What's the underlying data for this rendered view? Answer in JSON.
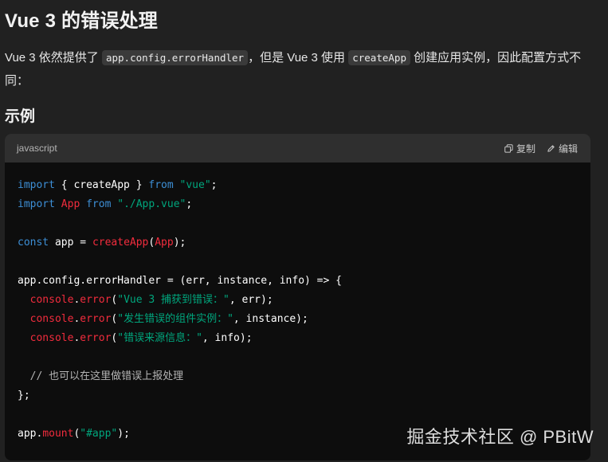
{
  "heading": "Vue 3 的错误处理",
  "paragraph": {
    "part1": "Vue 3 依然提供了 ",
    "code1": "app.config.errorHandler",
    "part2": "，但是 Vue 3 使用 ",
    "code2": "createApp",
    "part3": " 创建应用实例，因此配置方式不同："
  },
  "section_title": "示例",
  "code_block": {
    "language": "javascript",
    "copy_label": "复制",
    "edit_label": "编辑",
    "lines": [
      [
        {
          "t": "import",
          "c": "kw"
        },
        {
          "t": " { createApp } ",
          "c": "plain"
        },
        {
          "t": "from",
          "c": "kw"
        },
        {
          "t": " ",
          "c": "plain"
        },
        {
          "t": "\"vue\"",
          "c": "str"
        },
        {
          "t": ";",
          "c": "plain"
        }
      ],
      [
        {
          "t": "import",
          "c": "kw"
        },
        {
          "t": " ",
          "c": "plain"
        },
        {
          "t": "App",
          "c": "fn"
        },
        {
          "t": " ",
          "c": "plain"
        },
        {
          "t": "from",
          "c": "kw"
        },
        {
          "t": " ",
          "c": "plain"
        },
        {
          "t": "\"./App.vue\"",
          "c": "str"
        },
        {
          "t": ";",
          "c": "plain"
        }
      ],
      [],
      [
        {
          "t": "const",
          "c": "kw"
        },
        {
          "t": " app = ",
          "c": "plain"
        },
        {
          "t": "createApp",
          "c": "fn"
        },
        {
          "t": "(",
          "c": "plain"
        },
        {
          "t": "App",
          "c": "fn"
        },
        {
          "t": ");",
          "c": "plain"
        }
      ],
      [],
      [
        {
          "t": "app.config.errorHandler = (err, instance, info) => {",
          "c": "plain"
        }
      ],
      [
        {
          "t": "  ",
          "c": "plain"
        },
        {
          "t": "console",
          "c": "fn"
        },
        {
          "t": ".",
          "c": "plain"
        },
        {
          "t": "error",
          "c": "fn"
        },
        {
          "t": "(",
          "c": "plain"
        },
        {
          "t": "\"Vue 3 捕获到错误：\"",
          "c": "str"
        },
        {
          "t": ", err);",
          "c": "plain"
        }
      ],
      [
        {
          "t": "  ",
          "c": "plain"
        },
        {
          "t": "console",
          "c": "fn"
        },
        {
          "t": ".",
          "c": "plain"
        },
        {
          "t": "error",
          "c": "fn"
        },
        {
          "t": "(",
          "c": "plain"
        },
        {
          "t": "\"发生错误的组件实例：\"",
          "c": "str"
        },
        {
          "t": ", instance);",
          "c": "plain"
        }
      ],
      [
        {
          "t": "  ",
          "c": "plain"
        },
        {
          "t": "console",
          "c": "fn"
        },
        {
          "t": ".",
          "c": "plain"
        },
        {
          "t": "error",
          "c": "fn"
        },
        {
          "t": "(",
          "c": "plain"
        },
        {
          "t": "\"错误来源信息：\"",
          "c": "str"
        },
        {
          "t": ", info);",
          "c": "plain"
        }
      ],
      [],
      [
        {
          "t": "  // 也可以在这里做错误上报处理",
          "c": "cm"
        }
      ],
      [
        {
          "t": "};",
          "c": "plain"
        }
      ],
      [],
      [
        {
          "t": "app.",
          "c": "plain"
        },
        {
          "t": "mount",
          "c": "fn"
        },
        {
          "t": "(",
          "c": "plain"
        },
        {
          "t": "\"#app\"",
          "c": "str"
        },
        {
          "t": ");",
          "c": "plain"
        }
      ]
    ]
  },
  "watermark": "掘金技术社区 @ PBitW",
  "colors": {
    "background": "#212121",
    "code_background": "#0d0d0d",
    "keyword": "#3d8fd6",
    "string": "#00a67d",
    "function": "#f22c3d"
  },
  "icons": {
    "copy": "copy-icon",
    "edit": "edit-pen-icon"
  }
}
